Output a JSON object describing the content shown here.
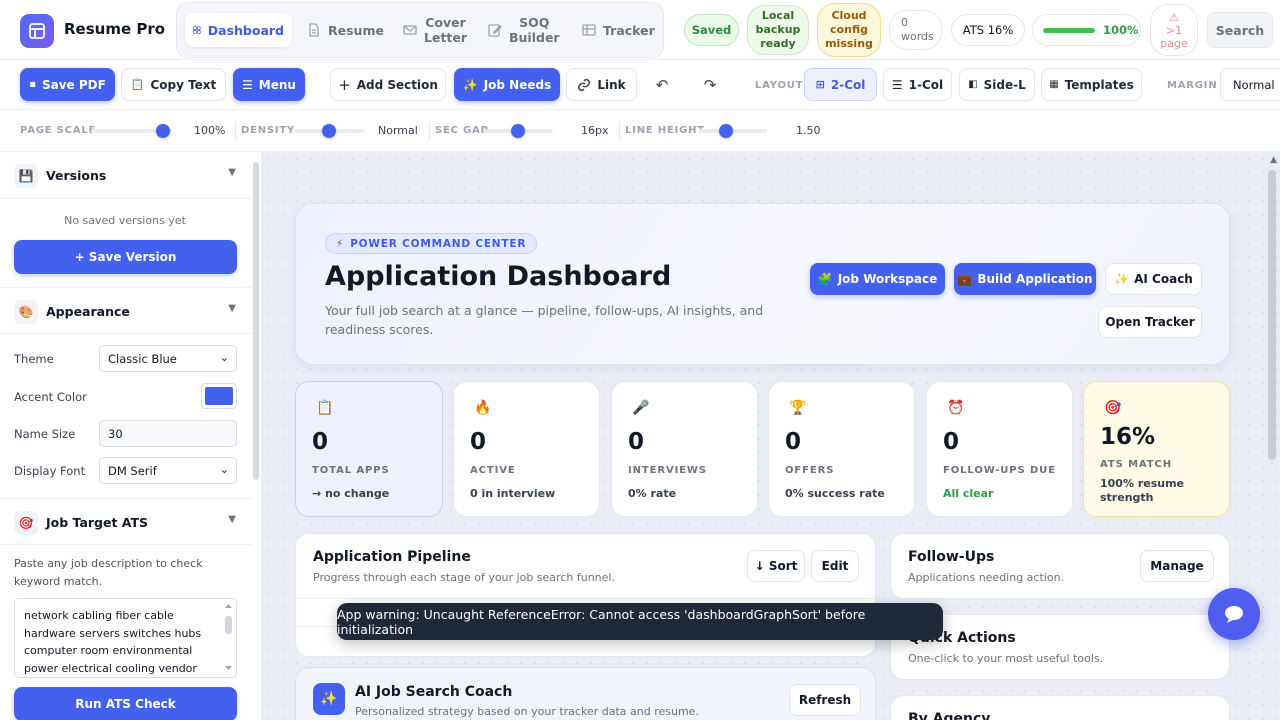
{
  "app": {
    "title": "Resume Pro"
  },
  "nav": {
    "dashboard": "Dashboard",
    "resume": "Resume",
    "cover_1": "Cover",
    "cover_2": "Letter",
    "soq_1": "SOQ",
    "soq_2": "Builder",
    "tracker": "Tracker"
  },
  "status": {
    "saved": "Saved",
    "local_1": "Local",
    "local_2": "backup",
    "local_3": "ready",
    "cloud_1": "Cloud",
    "cloud_2": "config",
    "cloud_3": "missing",
    "words_1": "0",
    "words_2": "words",
    "ats": "ATS 16%",
    "progress": "100%",
    "progress_value": 100,
    "warn_icon": "warning-icon",
    "warn_1": ">1",
    "warn_2": "page",
    "search": "Search"
  },
  "toolbar": {
    "save_pdf": "Save PDF",
    "copy_text": "Copy Text",
    "menu": "Menu",
    "add_section": "Add Section",
    "job_needs": "Job Needs",
    "link": "Link",
    "undo": "↶",
    "redo": "↷",
    "layout_label": "LAYOUT",
    "two_col": "2-Col",
    "one_col": "1-Col",
    "side_l": "Side-L",
    "templates": "Templates",
    "margin_label": "MARGIN",
    "margin_value": "Normal"
  },
  "sliders": {
    "page_scale_label": "PAGE SCALE",
    "page_scale_value": "100%",
    "density_label": "DENSITY",
    "density_value": "Normal",
    "sec_gap_label": "SEC GAP",
    "sec_gap_value": "16px",
    "line_height_label": "LINE HEIGHT",
    "line_height_value": "1.50"
  },
  "sidebar": {
    "versions_title": "Versions",
    "no_versions": "No saved versions yet",
    "save_version": "+ Save Version",
    "appearance_title": "Appearance",
    "theme_label": "Theme",
    "theme_value": "Classic Blue",
    "accent_label": "Accent Color",
    "accent_color": "#4361ee",
    "name_size_label": "Name Size",
    "name_size_value": "30",
    "display_font_label": "Display Font",
    "display_font_value": "DM Serif",
    "ats_title": "Job Target ATS",
    "ats_desc": "Paste any job description to check keyword match.",
    "ats_lines": [
      "network cabling fiber cable",
      "hardware servers switches hubs",
      "computer room environmental",
      "power electrical cooling vendor"
    ],
    "run_ats": "Run ATS Check"
  },
  "hero": {
    "badge": "POWER COMMAND CENTER",
    "title": "Application Dashboard",
    "subtitle": "Your full job search at a glance — pipeline, follow-ups, AI insights, and readiness scores.",
    "job_workspace": "Job Workspace",
    "build_application": "Build Application",
    "ai_coach": "AI Coach",
    "open_tracker": "Open Tracker"
  },
  "stats": [
    {
      "icon": "📋",
      "value": "0",
      "label": "TOTAL APPS",
      "foot": "→ no change"
    },
    {
      "icon": "🔥",
      "value": "0",
      "label": "ACTIVE",
      "foot": "0 in interview"
    },
    {
      "icon": "🎤",
      "value": "0",
      "label": "INTERVIEWS",
      "foot": "0% rate"
    },
    {
      "icon": "🏆",
      "value": "0",
      "label": "OFFERS",
      "foot": "0% success rate"
    },
    {
      "icon": "⏰",
      "value": "0",
      "label": "FOLLOW-UPS DUE",
      "foot": "All clear"
    },
    {
      "icon": "🎯",
      "value": "16%",
      "label": "ATS MATCH",
      "foot": "100% resume strength"
    }
  ],
  "pipeline": {
    "title": "Application Pipeline",
    "subtitle": "Progress through each stage of your job search funnel.",
    "sort": "↓ Sort",
    "edit": "Edit"
  },
  "followups": {
    "title": "Follow-Ups",
    "subtitle": "Applications needing action.",
    "manage": "Manage"
  },
  "quick_actions": {
    "title": "Quick Actions",
    "subtitle": "One-click to your most useful tools."
  },
  "by_agency": {
    "title": "By Agency"
  },
  "coach": {
    "title": "AI Job Search Coach",
    "subtitle": "Personalized strategy based on your tracker data and resume.",
    "refresh": "Refresh"
  },
  "toast": {
    "message": "App warning: Uncaught ReferenceError: Cannot access 'dashboardGraphSort' before initialization"
  },
  "colors": {
    "accent": "#4361ee",
    "success": "#2f9e44",
    "warning": "#9a5a00"
  }
}
